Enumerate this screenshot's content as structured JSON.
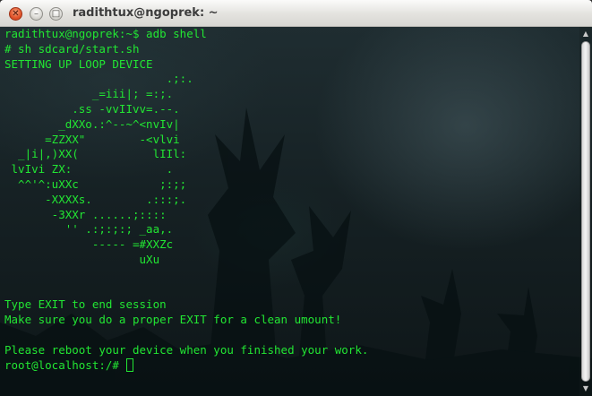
{
  "window": {
    "title": "radithtux@ngoprek: ~",
    "buttons": {
      "close_glyph": "✕",
      "minimize_glyph": "–",
      "maximize_glyph": "□"
    }
  },
  "terminal": {
    "text_color": "#22e633",
    "lines": [
      "radithtux@ngoprek:~$ adb shell",
      "# sh sdcard/start.sh",
      "SETTING UP LOOP DEVICE",
      "                        .;:.",
      "             _=iii|; =:;.",
      "          .ss -vvIIvv=.--.",
      "        _dXXo.:^--~^<nvIv|",
      "      =ZZXX\"        -<vlvi",
      "  _|i|,)XX(           lIIl:",
      " lvIvi ZX:              .",
      "  ^^'^:uXXc            ;:;;",
      "      -XXXXs.        .:::;.",
      "       -3XXr ......;::::",
      "         '' .:;:;:; _aa,.",
      "             ----- =#XXZc",
      "                    uXu",
      "",
      "",
      "Type EXIT to end session",
      "Make sure you do a proper EXIT for a clean umount!",
      "",
      "Please reboot your device when you finished your work."
    ],
    "prompt": "root@localhost:/# "
  },
  "scrollbar": {
    "up_glyph": "▲",
    "down_glyph": "▼"
  }
}
